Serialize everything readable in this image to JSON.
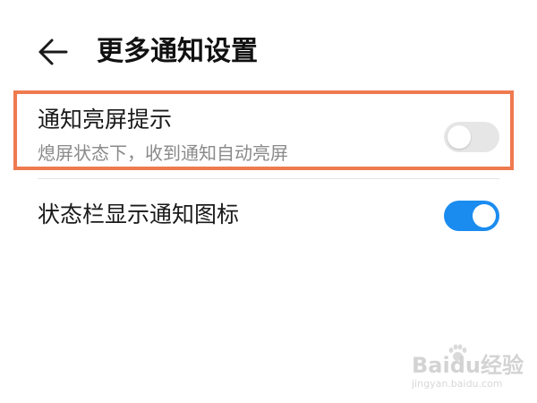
{
  "header": {
    "back_icon": "arrow-left-icon",
    "title": "更多通知设置"
  },
  "settings": [
    {
      "label": "通知亮屏提示",
      "description": "熄屏状态下，收到通知自动亮屏",
      "toggle_state": "off",
      "highlighted": true
    },
    {
      "label": "状态栏显示通知图标",
      "toggle_state": "on"
    }
  ],
  "colors": {
    "toggle_on": "#1a8cf0",
    "toggle_off": "#e6e6e6",
    "highlight_border": "#ef7a4f",
    "secondary_text": "#8a8a8a"
  },
  "watermark": {
    "brand": "Baidu经验",
    "url": "jingyan.baidu.com"
  }
}
